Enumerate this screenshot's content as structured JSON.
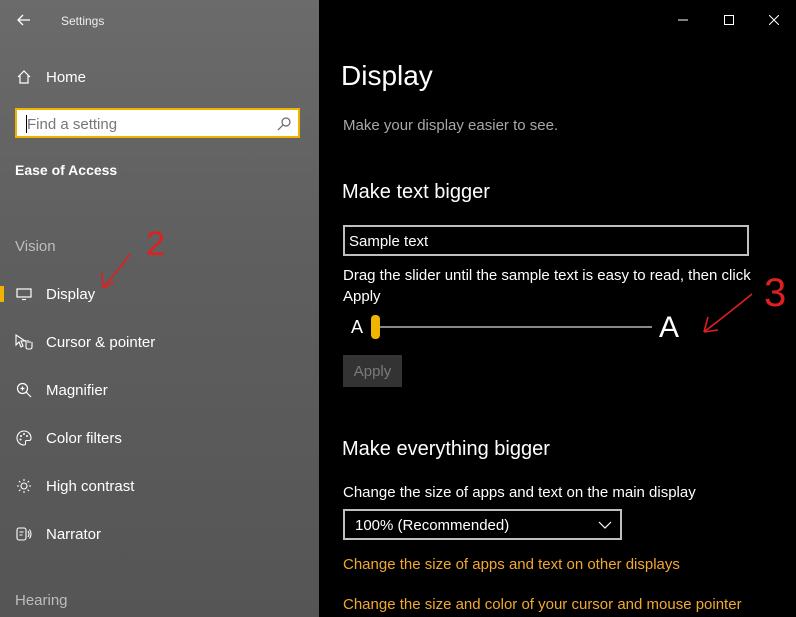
{
  "window": {
    "title": "Settings"
  },
  "sidebar": {
    "home_label": "Home",
    "search_placeholder": "Find a setting",
    "section_title": "Ease of Access",
    "vision_label": "Vision",
    "items": [
      {
        "label": "Display",
        "icon": "monitor-icon",
        "selected": true
      },
      {
        "label": "Cursor & pointer",
        "icon": "pointer-icon"
      },
      {
        "label": "Magnifier",
        "icon": "magnifier-icon"
      },
      {
        "label": "Color filters",
        "icon": "palette-icon"
      },
      {
        "label": "High contrast",
        "icon": "sun-icon"
      },
      {
        "label": "Narrator",
        "icon": "narrator-icon"
      }
    ],
    "hearing_label": "Hearing"
  },
  "main": {
    "title": "Display",
    "description": "Make your display easier to see.",
    "text_section": {
      "heading": "Make text bigger",
      "sample_text": "Sample text",
      "hint": "Drag the slider until the sample text is easy to read, then click Apply",
      "small_glyph": "A",
      "large_glyph": "A",
      "slider_value_fraction": 0.0,
      "apply_label": "Apply"
    },
    "everything_section": {
      "heading": "Make everything bigger",
      "label": "Change the size of apps and text on the main display",
      "scale_value": "100% (Recommended)",
      "link_other_displays": "Change the size of apps and text on other displays",
      "link_cursor": "Change the size and color of your cursor and mouse pointer"
    }
  },
  "annotations": [
    "2",
    "3"
  ],
  "colors": {
    "accent": "#f0b400",
    "link": "#f0a830",
    "annotation": "#e02020"
  }
}
